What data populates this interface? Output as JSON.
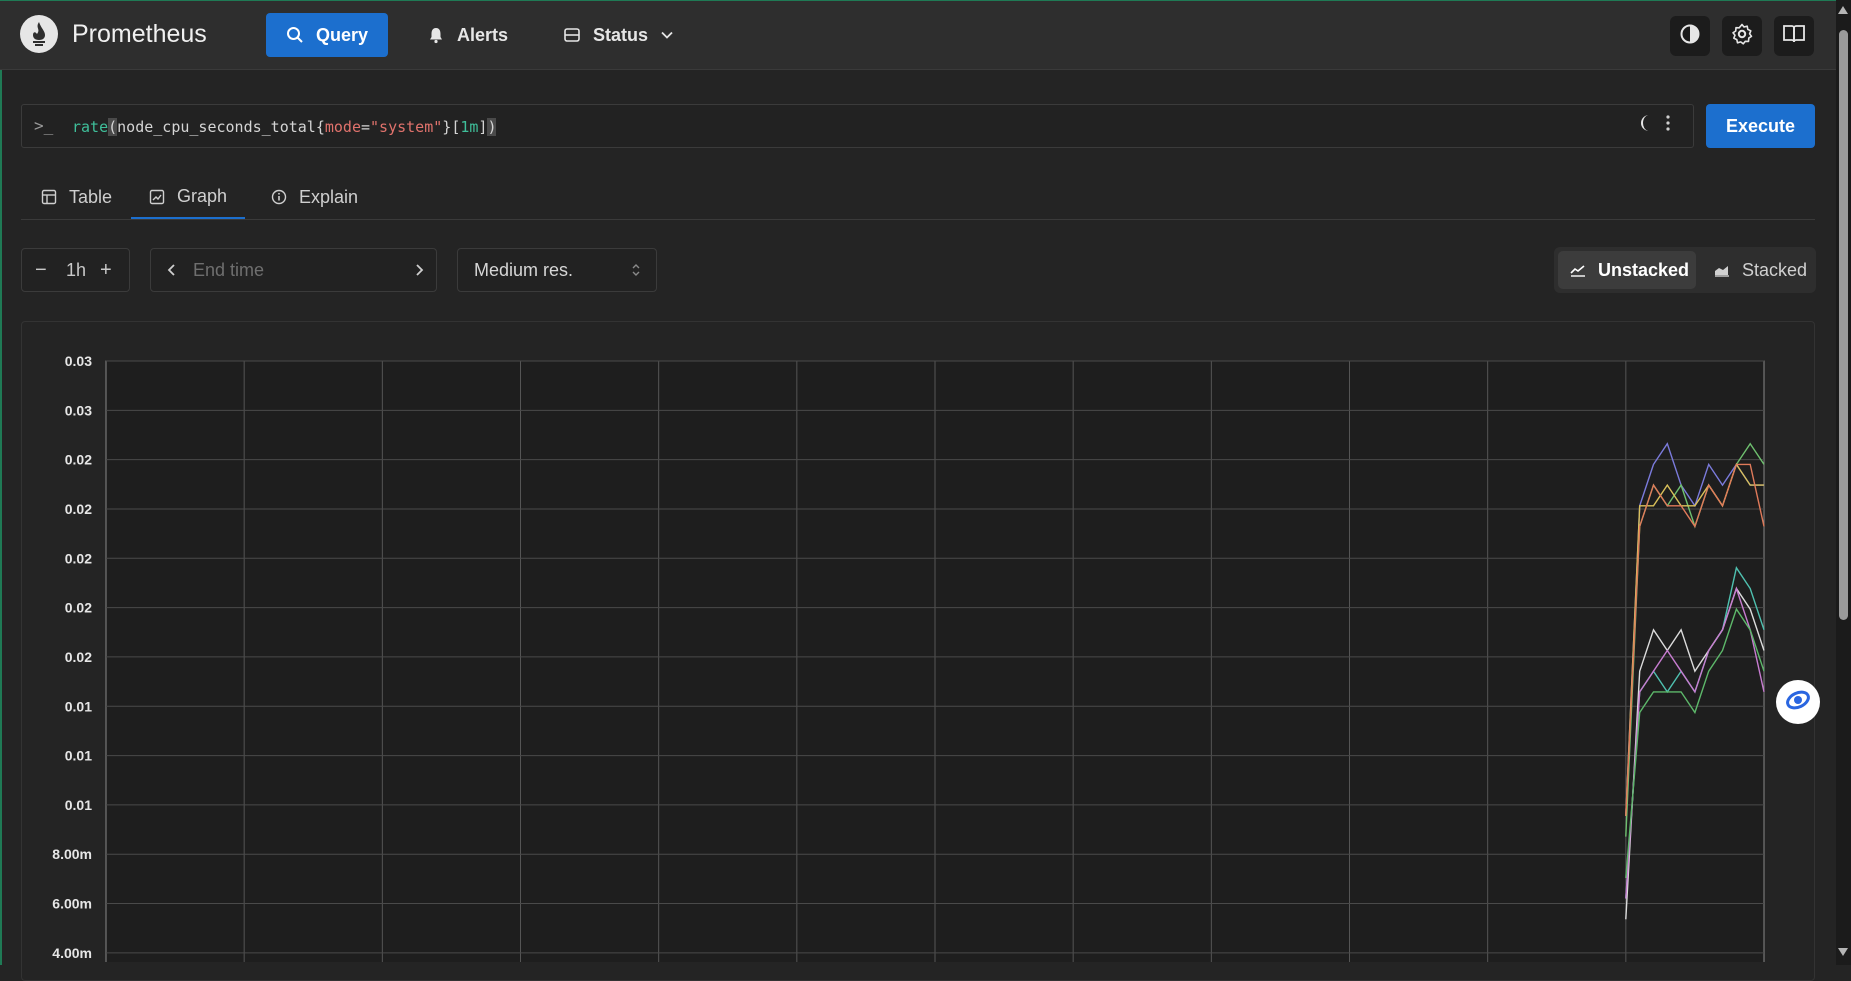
{
  "app": {
    "title": "Prometheus"
  },
  "nav": {
    "query_label": "Query",
    "alerts_label": "Alerts",
    "status_label": "Status"
  },
  "query": {
    "prompt": ">_",
    "expression": "rate(node_cpu_seconds_total{mode=\"system\"}[1m])",
    "tokens": {
      "fn": "rate",
      "open_paren": "(",
      "metric": "node_cpu_seconds_total",
      "brace_open": "{",
      "label_name": "mode",
      "op": "=",
      "label_value": "\"system\"",
      "brace_close": "}",
      "range_open": "[",
      "range": "1m",
      "range_close": "]",
      "close_paren": ")"
    },
    "execute_label": "Execute"
  },
  "tabs": [
    {
      "label": "Table",
      "icon": "table-icon",
      "active": false
    },
    {
      "label": "Graph",
      "icon": "graph-icon",
      "active": true
    },
    {
      "label": "Explain",
      "icon": "info-icon",
      "active": false
    }
  ],
  "controls": {
    "range_minus": "−",
    "range_value": "1h",
    "range_plus": "+",
    "end_time_placeholder": "End time",
    "resolution_value": "Medium res.",
    "unstacked_label": "Unstacked",
    "stacked_label": "Stacked"
  },
  "colors": {
    "accent": "#1c6fce",
    "bg": "#242424",
    "topbar": "#2e2e2e"
  },
  "chart_data": {
    "type": "line",
    "y_tick_labels": [
      "0.03",
      "0.03",
      "0.02",
      "0.02",
      "0.02",
      "0.02",
      "0.02",
      "0.01",
      "0.01",
      "0.01",
      "8.00m",
      "6.00m",
      "4.00m"
    ],
    "y_tick_values": [
      0.032,
      0.03,
      0.028,
      0.026,
      0.024,
      0.022,
      0.02,
      0.018,
      0.016,
      0.014,
      0.008,
      0.006,
      0.004
    ],
    "ylim": [
      0.004,
      0.032
    ],
    "xlim_minutes": [
      -60,
      0
    ],
    "grid": true,
    "series": [
      {
        "color": "#7b7bdc",
        "x": [
          -5,
          -4.5,
          -4,
          -3.5,
          -3,
          -2.5,
          -2,
          -1.5,
          -1,
          -0.5,
          0
        ],
        "y": [
          0.01,
          0.025,
          0.027,
          0.028,
          0.026,
          0.025,
          0.027,
          0.026,
          0.027,
          0.026,
          0.026
        ]
      },
      {
        "color": "#6fc06f",
        "x": [
          -5,
          -4.5,
          -4,
          -3.5,
          -3,
          -2.5,
          -2,
          -1.5,
          -1,
          -0.5,
          0
        ],
        "y": [
          0.009,
          0.024,
          0.026,
          0.025,
          0.026,
          0.024,
          0.026,
          0.025,
          0.027,
          0.028,
          0.027
        ]
      },
      {
        "color": "#d9c05a",
        "x": [
          -5,
          -4.5,
          -4,
          -3.5,
          -3,
          -2.5,
          -2,
          -1.5,
          -1,
          -0.5,
          0
        ],
        "y": [
          0.01,
          0.025,
          0.025,
          0.026,
          0.025,
          0.025,
          0.026,
          0.025,
          0.027,
          0.026,
          0.026
        ]
      },
      {
        "color": "#e07a5a",
        "x": [
          -5,
          -4.5,
          -4,
          -3.5,
          -3,
          -2.5,
          -2,
          -1.5,
          -1,
          -0.5,
          0
        ],
        "y": [
          0.01,
          0.024,
          0.026,
          0.025,
          0.025,
          0.024,
          0.026,
          0.025,
          0.027,
          0.027,
          0.024
        ]
      },
      {
        "color": "#4fc1b0",
        "x": [
          -5,
          -4.5,
          -4,
          -3.5,
          -3,
          -2.5,
          -2,
          -1.5,
          -1,
          -0.5,
          0
        ],
        "y": [
          0.006,
          0.016,
          0.017,
          0.016,
          0.017,
          0.016,
          0.018,
          0.019,
          0.022,
          0.021,
          0.019
        ]
      },
      {
        "color": "#dcdcdc",
        "x": [
          -5,
          -4.5,
          -4,
          -3.5,
          -3,
          -2.5,
          -2,
          -1.5,
          -1,
          -0.5,
          0
        ],
        "y": [
          0.005,
          0.017,
          0.019,
          0.018,
          0.019,
          0.017,
          0.018,
          0.019,
          0.021,
          0.02,
          0.018
        ]
      },
      {
        "color": "#c77cd0",
        "x": [
          -5,
          -4.5,
          -4,
          -3.5,
          -3,
          -2.5,
          -2,
          -1.5,
          -1,
          -0.5,
          0
        ],
        "y": [
          0.006,
          0.016,
          0.017,
          0.018,
          0.017,
          0.016,
          0.018,
          0.019,
          0.021,
          0.019,
          0.016
        ]
      },
      {
        "color": "#5db86a",
        "x": [
          -5,
          -4.5,
          -4,
          -3.5,
          -3,
          -2.5,
          -2,
          -1.5,
          -1,
          -0.5,
          0
        ],
        "y": [
          0.007,
          0.015,
          0.016,
          0.016,
          0.016,
          0.015,
          0.017,
          0.018,
          0.02,
          0.019,
          0.017
        ]
      }
    ]
  }
}
